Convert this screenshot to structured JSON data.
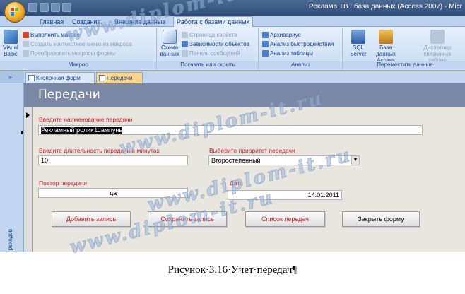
{
  "window": {
    "title": "Реклама ТВ : база данных (Access 2007) - Micr"
  },
  "ribbon": {
    "tabs": [
      "Главная",
      "Создание",
      "Внешние данные",
      "Работа с базами данных"
    ],
    "active_tab": "Работа с базами данных",
    "groups": {
      "macro": {
        "label": "Макрос",
        "visual_basic": "Visual Basic",
        "run_macro": "Выполнить макрос",
        "context_menu": "Создать контекстное меню из макроса",
        "convert_macros": "Преобразовать макросы формы"
      },
      "show_hide": {
        "label": "Показать или скрыть",
        "schema": "Схема данных",
        "property_sheet": "Страница свойств",
        "dependencies": "Зависимости объектов",
        "message_bar": "Панель сообщений"
      },
      "analyze": {
        "label": "Анализ",
        "archiver": "Архивариус",
        "performance": "Анализ быстродействия",
        "table_analyze": "Анализ таблицы"
      },
      "move_data": {
        "label": "Переместить данные",
        "sql_server": "SQL Server",
        "access_db": "Базa данных Access",
        "linked_tables": "Диспетчер связанных таблиц"
      }
    }
  },
  "doc_tabs": {
    "toggle": "»",
    "items": [
      "Кнопочная форм",
      "Передачи"
    ],
    "active": "Передачи"
  },
  "nav_pane": {
    "label": "реходов"
  },
  "form": {
    "title": "Передачи",
    "name_label": "Введите наименование передачи",
    "name_value": "Рекламный ролик Шампунь",
    "duration_label": "Введите длительность передачи в минутах",
    "duration_value": "10",
    "priority_label": "Выберите приоритет передачи",
    "priority_value": "Второстепенный",
    "repeat_label": "Повтор передачи",
    "repeat_value": "да",
    "date_label": "Дата",
    "date_value": "14.01.2011",
    "buttons": {
      "add": "Добавить запись",
      "save": "Сохранить запись",
      "list": "Список передач",
      "close": "Закрыть форму"
    }
  },
  "watermark": "www.diplom-it.ru",
  "caption": "Рисунок·3.16·Учет·передач¶",
  "colors": {
    "accent_red": "#c4242d",
    "form_header": "#7a88a5",
    "form_body": "#e9e6e0",
    "ribbon": "#c9dbf3"
  }
}
